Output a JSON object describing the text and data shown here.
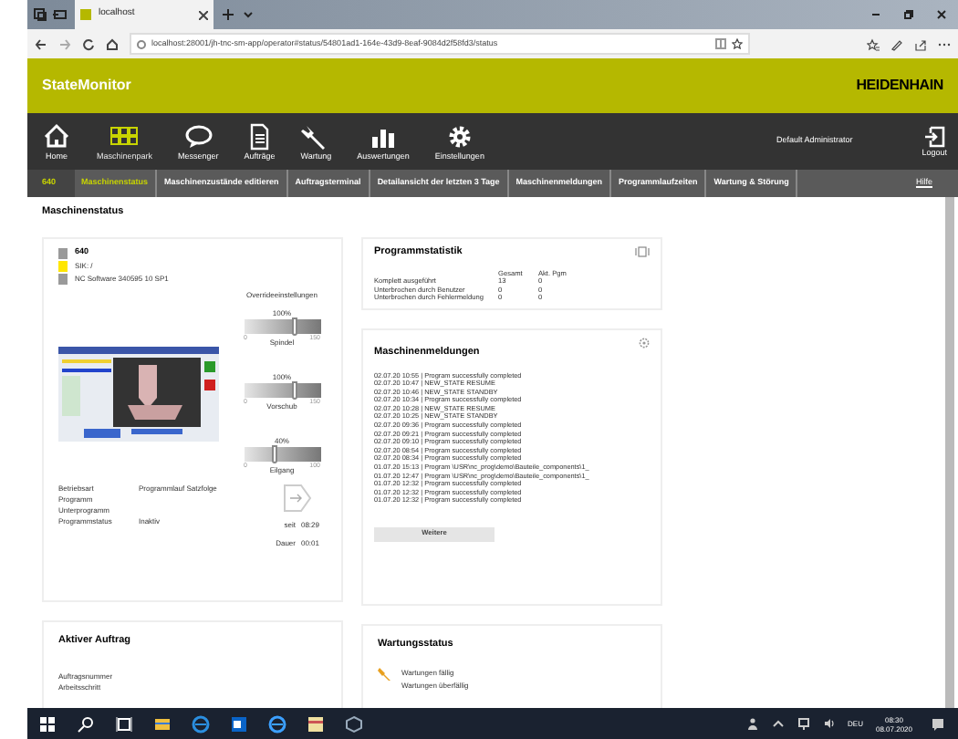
{
  "browser": {
    "tabs": [
      {
        "title": "localhost",
        "selected": true
      }
    ],
    "url": "localhost:28001/jh-tnc-sm-app/operator#status/54801ad1-164e-43d9-8eaf-9084d2f58fd3/status"
  },
  "app": {
    "title": "StateMonitor",
    "brand": "HEIDENHAIN"
  },
  "toolbar": {
    "items": [
      {
        "label": "Home",
        "kind": "home",
        "selected": false
      },
      {
        "label": "Maschinenpark",
        "kind": "grid",
        "selected": true
      },
      {
        "label": "Messenger",
        "kind": "bubble",
        "selected": false
      },
      {
        "label": "Aufträge",
        "kind": "document",
        "selected": false
      },
      {
        "label": "Wartung",
        "kind": "wrench",
        "selected": false
      },
      {
        "label": "Auswertungen",
        "kind": "bars",
        "selected": false
      },
      {
        "label": "Einstellungen",
        "kind": "gear",
        "selected": false
      }
    ],
    "user": "Default Administrator",
    "logout": "Logout"
  },
  "nav": {
    "machine": "640",
    "tabs": [
      {
        "label": "Maschinenstatus",
        "selected": true
      },
      {
        "label": "Maschinenzustände editieren",
        "selected": false
      },
      {
        "label": "Auftragsterminal",
        "selected": false
      },
      {
        "label": "Detailansicht der letzten 3 Tage",
        "selected": false
      },
      {
        "label": "Maschinenmeldungen",
        "selected": false
      },
      {
        "label": "Programmlaufzeiten",
        "selected": false
      },
      {
        "label": "Wartung & Störung",
        "selected": false
      }
    ],
    "help": "Hilfe"
  },
  "page_title": "Maschinenstatus",
  "machine": {
    "info": [
      {
        "text": "640",
        "color": "#9a9a9a"
      },
      {
        "text": "SIK: /",
        "color": "#ffe600"
      },
      {
        "text": "NC Software 340595 10 SP1",
        "color": "#9a9a9a"
      }
    ],
    "overrides_title": "Overrideeinstellungen",
    "overrides": [
      {
        "value": "100%",
        "level": 0.667,
        "min": "0",
        "max": "150",
        "label": "Spindel"
      },
      {
        "value": "100%",
        "level": 0.667,
        "min": "0",
        "max": "150",
        "label": "Vorschub"
      },
      {
        "value": "40%",
        "level": 0.4,
        "min": "0",
        "max": "100",
        "label": "Eilgang"
      }
    ],
    "status": [
      {
        "label": "Betriebsart",
        "value": "Programmlauf Satzfolge"
      },
      {
        "label": "Programm"
      },
      {
        "label": "Unterprogramm"
      },
      {
        "label": "Programmstatus",
        "value": "Inaktiv"
      }
    ],
    "since_label": "seit",
    "since": "08:29",
    "duration_label": "Dauer",
    "duration": "00:01"
  },
  "stats": {
    "title": "Programmstatistik",
    "columns": [
      "Gesamt",
      "Akt. Pgm"
    ],
    "rows": [
      {
        "label": "Komplett ausgeführt",
        "values": [
          "13",
          "0"
        ]
      },
      {
        "label": "Unterbrochen durch Benutzer",
        "values": [
          "0",
          "0"
        ]
      },
      {
        "label": "Unterbrochen durch Fehlermeldung",
        "values": [
          "0",
          "0"
        ]
      }
    ]
  },
  "messages": {
    "title": "Maschinenmeldungen",
    "items": [
      "02.07.20 10:55 | Program  successfully completed",
      "02.07.20 10:47 | NEW_STATE RESUME",
      "02.07.20 10:46 | NEW_STATE STANDBY",
      "02.07.20 10:34 | Program  successfully completed",
      "02.07.20 10:28 | NEW_STATE RESUME",
      "02.07.20 10:25 | NEW_STATE STANDBY",
      "02.07.20 09:36 | Program  successfully completed",
      "02.07.20 09:21 | Program  successfully completed",
      "02.07.20 09:10 | Program  successfully completed",
      "02.07.20 08:54 | Program  successfully completed",
      "02.07.20 08:34 | Program  successfully completed",
      "01.07.20 15:13 | Program \\USR\\nc_prog\\demo\\Bauteile_components\\1_",
      "01.07.20 12:47 | Program \\USR\\nc_prog\\demo\\Bauteile_components\\1_",
      "01.07.20 12:32 | Program  successfully completed",
      "01.07.20 12:32 | Program  successfully completed",
      "01.07.20 12:32 | Program  successfully completed"
    ],
    "button": "Weitere"
  },
  "active_order": {
    "title": "Aktiver Auftrag",
    "fields": [
      "Auftragsnummer",
      "Arbeitsschritt"
    ]
  },
  "maintenance": {
    "title": "Wartungsstatus",
    "items": [
      "Wartungen fällig",
      "Wartungen überfällig"
    ]
  },
  "taskbar": {
    "language": "DEU",
    "time": "08:30",
    "date": "08.07.2020"
  }
}
